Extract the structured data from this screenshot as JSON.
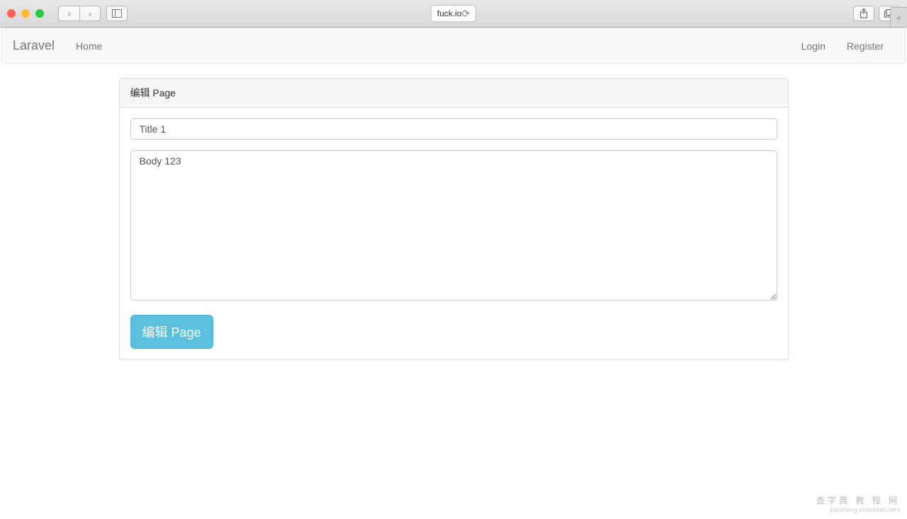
{
  "browser": {
    "url": "fuck.io",
    "nav_back_icon": "‹",
    "nav_fwd_icon": "›",
    "reload_icon": "⟳",
    "share_icon": "⇪",
    "tabs_icon": "⧉",
    "new_tab_icon": "+"
  },
  "navbar": {
    "brand": "Laravel",
    "home_label": "Home",
    "login_label": "Login",
    "register_label": "Register"
  },
  "panel": {
    "heading": "编辑 Page"
  },
  "form": {
    "title_value": "Title 1",
    "body_value": "Body 123",
    "submit_label": "编辑 Page"
  },
  "watermark": {
    "main": "查字典 教 程 网",
    "sub": "jiaocheng.chazidian.com"
  }
}
